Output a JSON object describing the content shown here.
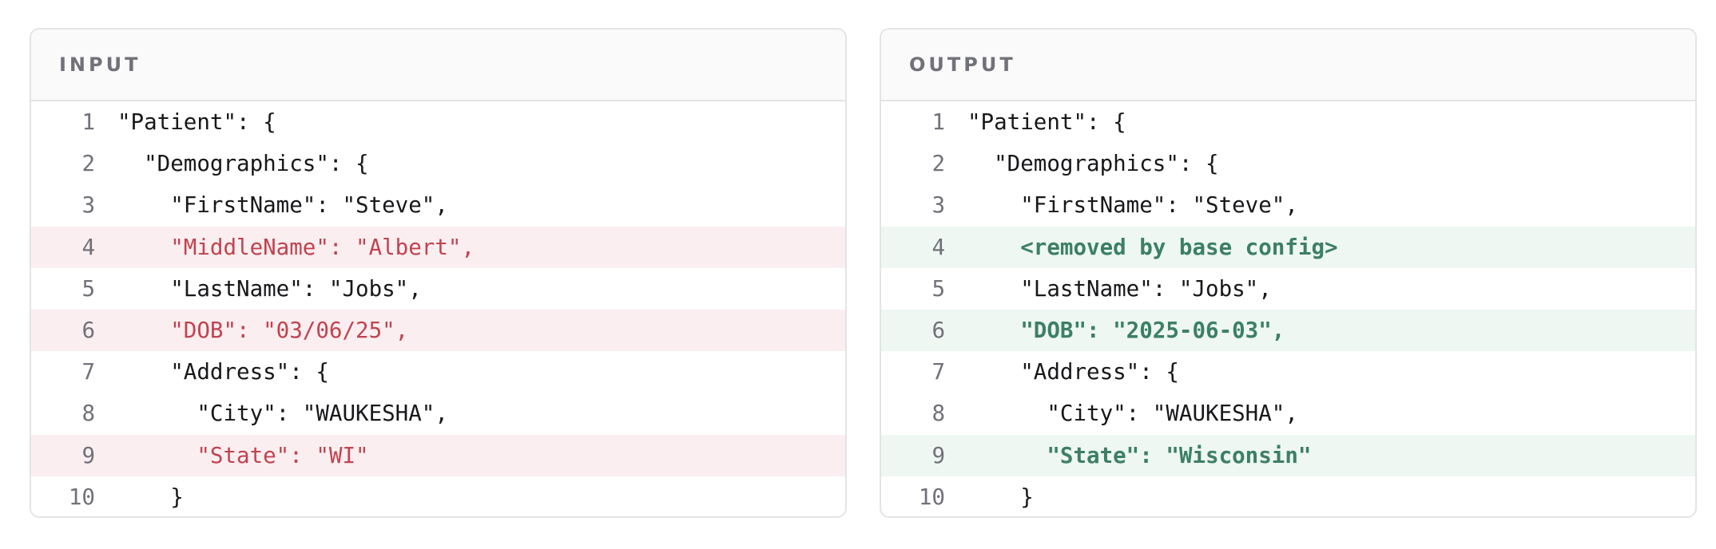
{
  "panels": {
    "input": {
      "title": "INPUT",
      "lines": [
        {
          "num": "1",
          "text": "\"Patient\": {",
          "state": "normal"
        },
        {
          "num": "2",
          "text": "  \"Demographics\": {",
          "state": "normal"
        },
        {
          "num": "3",
          "text": "    \"FirstName\": \"Steve\",",
          "state": "normal"
        },
        {
          "num": "4",
          "text": "    \"MiddleName\": \"Albert\",",
          "state": "removed"
        },
        {
          "num": "5",
          "text": "    \"LastName\": \"Jobs\",",
          "state": "normal"
        },
        {
          "num": "6",
          "text": "    \"DOB\": \"03/06/25\",",
          "state": "removed"
        },
        {
          "num": "7",
          "text": "    \"Address\": {",
          "state": "normal"
        },
        {
          "num": "8",
          "text": "      \"City\": \"WAUKESHA\",",
          "state": "normal"
        },
        {
          "num": "9",
          "text": "      \"State\": \"WI\"",
          "state": "removed"
        },
        {
          "num": "10",
          "text": "    }",
          "state": "normal"
        }
      ]
    },
    "output": {
      "title": "OUTPUT",
      "lines": [
        {
          "num": "1",
          "text": "\"Patient\": {",
          "state": "normal"
        },
        {
          "num": "2",
          "text": "  \"Demographics\": {",
          "state": "normal"
        },
        {
          "num": "3",
          "text": "    \"FirstName\": \"Steve\",",
          "state": "normal"
        },
        {
          "num": "4",
          "text": "    <removed by base config>",
          "state": "added"
        },
        {
          "num": "5",
          "text": "    \"LastName\": \"Jobs\",",
          "state": "normal"
        },
        {
          "num": "6",
          "text": "    \"DOB\": \"2025-06-03\",",
          "state": "added"
        },
        {
          "num": "7",
          "text": "    \"Address\": {",
          "state": "normal"
        },
        {
          "num": "8",
          "text": "      \"City\": \"WAUKESHA\",",
          "state": "normal"
        },
        {
          "num": "9",
          "text": "      \"State\": \"Wisconsin\"",
          "state": "added"
        },
        {
          "num": "10",
          "text": "    }",
          "state": "normal"
        }
      ]
    }
  },
  "colors": {
    "removed_bg": "#fbeef0",
    "removed_text": "#c0434f",
    "added_bg": "#eef7f2",
    "added_text": "#3c7f67"
  }
}
